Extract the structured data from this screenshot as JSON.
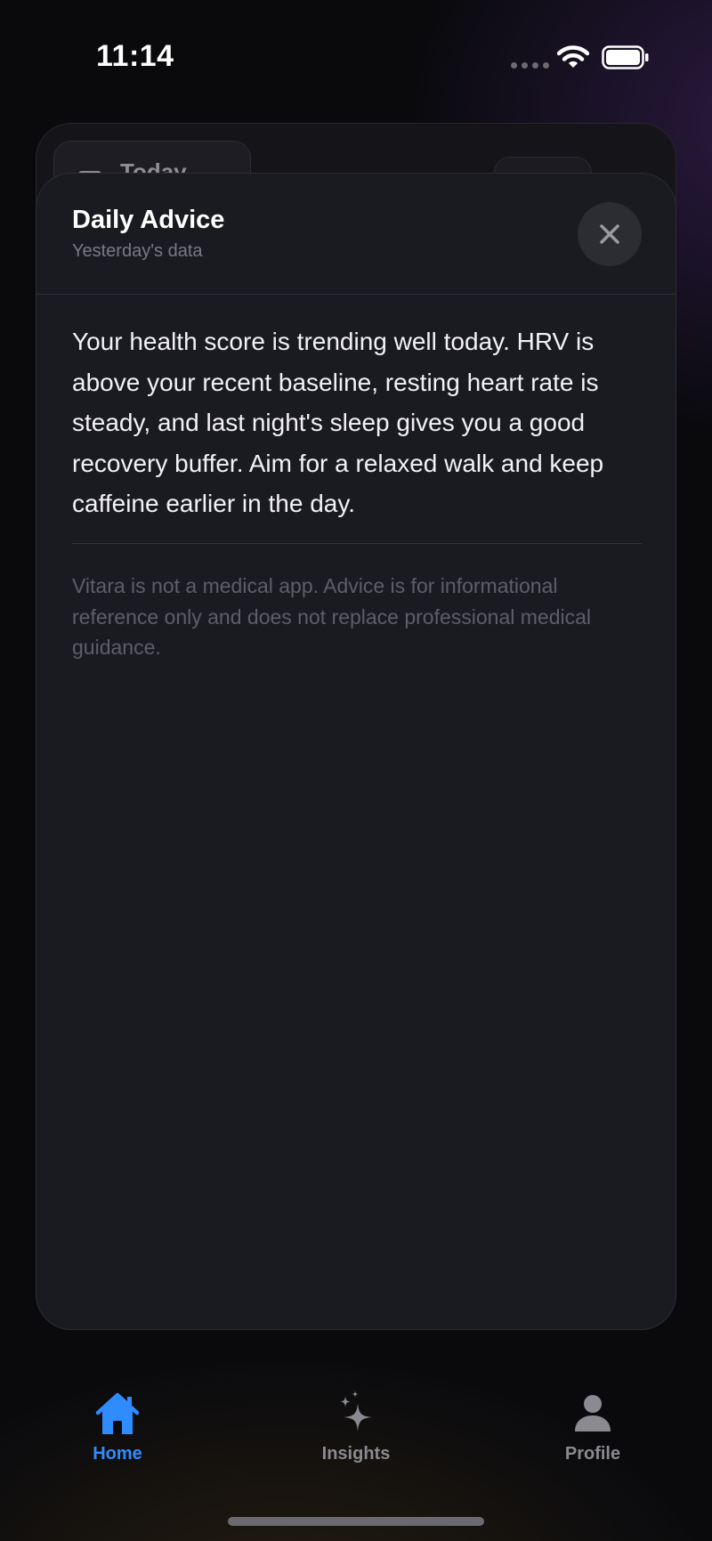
{
  "status_bar": {
    "time": "11:14"
  },
  "background_card": {
    "label": "Today"
  },
  "sheet": {
    "title": "Daily Advice",
    "subtitle": "Yesterday's data",
    "body": "Your health score is trending well today. HRV is above your recent baseline, resting heart rate is steady, and last night's sleep gives you a good recovery buffer. Aim for a relaxed walk and keep caffeine earlier in the day.",
    "disclaimer": "Vitara is not a medical app. Advice is for informational reference only and does not replace professional medical guidance.",
    "close_icon": "close-icon"
  },
  "tab_bar": {
    "items": [
      {
        "label": "Home",
        "icon": "house-icon",
        "active": true
      },
      {
        "label": "Insights",
        "icon": "sparkles-icon",
        "active": false
      },
      {
        "label": "Profile",
        "icon": "person-icon",
        "active": false
      }
    ]
  },
  "colors": {
    "accent": "#2f8cff",
    "inactive": "#8a8a90",
    "sheet_bg": "#1a1a21"
  }
}
